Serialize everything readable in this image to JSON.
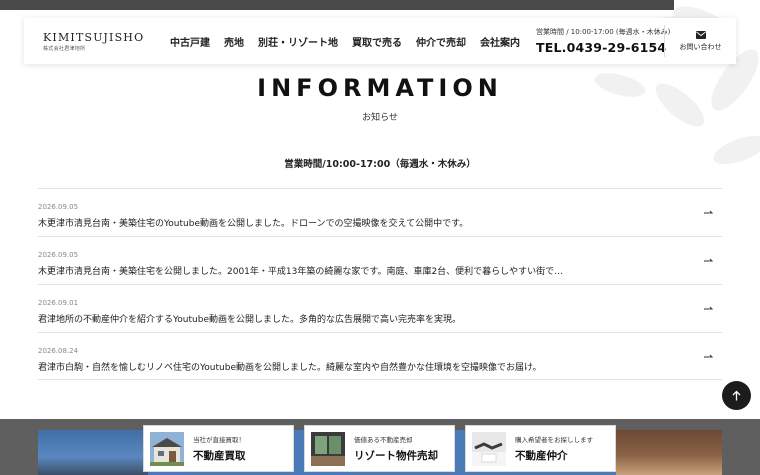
{
  "header": {
    "logo_main": "KIMITSUJISHO",
    "logo_sub": "株式会社君津地所",
    "nav": [
      {
        "label": "中古戸建"
      },
      {
        "label": "売地"
      },
      {
        "label": "別荘・リゾート地"
      },
      {
        "label": "買取で売る"
      },
      {
        "label": "仲介で売却"
      },
      {
        "label": "会社案内"
      }
    ],
    "hours": "営業時間 / 10:00-17:00 (毎週水・木休み)",
    "tel": "TEL.0439-29-6154",
    "contact_label": "お問い合わせ",
    "contact_icon": "mail-icon"
  },
  "information": {
    "title": "INFORMATION",
    "subtitle": "お知らせ",
    "hours": "営業時間/10:00-17:00（毎週水・木休み）"
  },
  "news": [
    {
      "date": "2026.09.05",
      "text": "木更津市清見台南・美築住宅のYoutube動画を公開しました。ドローンでの空撮映像を交えて公開中です。"
    },
    {
      "date": "2026.09.05",
      "text": "木更津市清見台南・美築住宅を公開しました。2001年・平成13年築の綺麗な家です。南庭、車庫2台、便利で暮らしやすい街で…"
    },
    {
      "date": "2026.09.01",
      "text": "君津地所の不動産仲介を紹介するYoutube動画を公開しました。多角的な広告展開で高い完売率を実現。"
    },
    {
      "date": "2026.08.24",
      "text": "君津市白駒・自然を愉しむリノベ住宅のYoutube動画を公開しました。綺麗な室内や自然豊かな住環境を空撮映像でお届け。"
    }
  ],
  "cta": [
    {
      "small": "当社が直接買取！",
      "big": "不動産買取"
    },
    {
      "small": "価値ある不動産売却",
      "big": "リゾート物件売却"
    },
    {
      "small": "購入希望者をお探しします",
      "big": "不動産仲介"
    }
  ],
  "colors": {
    "accent_dark": "#1c1c1c",
    "footer_band": "#5f5f5f",
    "divider": "#e2e2e2"
  }
}
